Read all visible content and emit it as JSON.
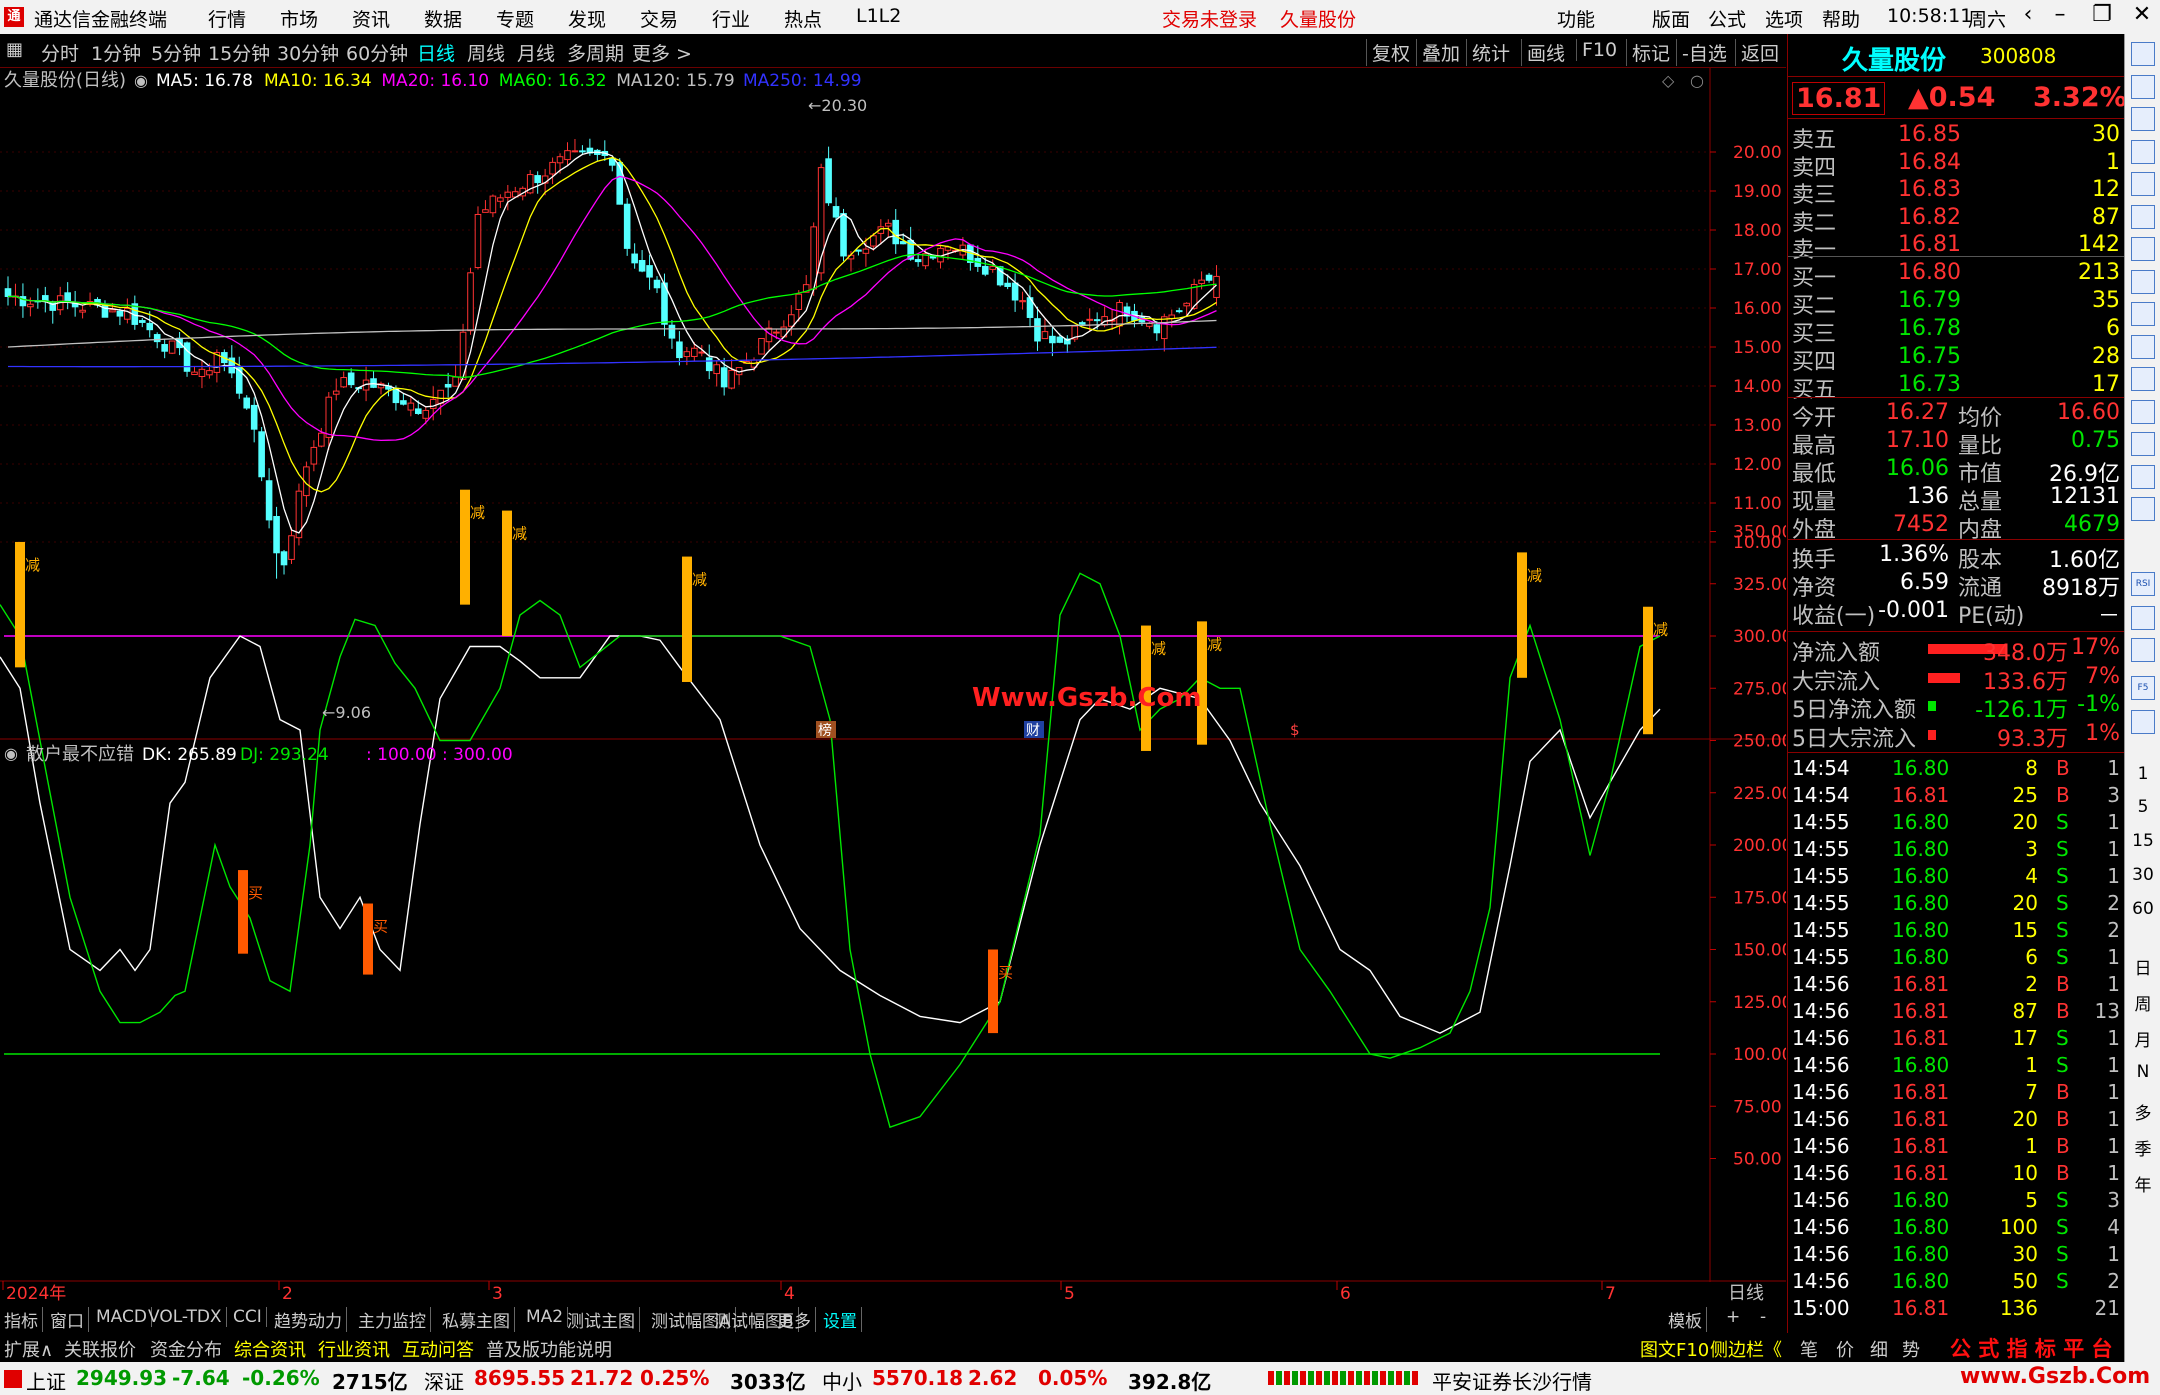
{
  "titlebar": {
    "app_title": "通达信金融终端",
    "menus": [
      "行情",
      "市场",
      "资讯",
      "数据",
      "专题",
      "发现",
      "交易",
      "行业",
      "热点",
      "L1L2"
    ],
    "trade_status": "交易未登录",
    "stock_link": "久量股份",
    "right_menus": [
      "功能",
      "版面",
      "公式",
      "选项",
      "帮助"
    ],
    "time": "10:58:11",
    "weekday": "周六"
  },
  "period_tabs": [
    "分时",
    "1分钟",
    "5分钟",
    "15分钟",
    "30分钟",
    "60分钟",
    "日线",
    "周线",
    "月线",
    "多周期",
    "更多 >"
  ],
  "selected_period": "日线",
  "tool_buttons": [
    "复权",
    "叠加",
    "统计",
    "画线",
    "F10",
    "标记",
    "-自选",
    "返回"
  ],
  "main_chart": {
    "title": "久量股份(日线)",
    "ma_labels": [
      {
        "text": "MA5: 16.78",
        "color": "#ffffff"
      },
      {
        "text": "MA10: 16.34",
        "color": "#ffff00"
      },
      {
        "text": "MA20: 16.10",
        "color": "#ff00ff"
      },
      {
        "text": "MA60: 16.32",
        "color": "#00ff00"
      },
      {
        "text": "MA120: 15.79",
        "color": "#c0c0c0"
      },
      {
        "text": "MA250: 14.99",
        "color": "#3232ff"
      }
    ],
    "y_ticks": [
      "20.00",
      "19.00",
      "18.00",
      "17.00",
      "16.00",
      "15.00",
      "14.00",
      "13.00",
      "12.00",
      "11.00",
      "10.00"
    ],
    "high_label": "20.30",
    "low_label": "9.06",
    "watermark": "Www.Gszb.Com",
    "event_marks": [
      "榜",
      "财",
      "$"
    ]
  },
  "indicator": {
    "title": "散户最不应错",
    "dk_label": "DK: 265.89",
    "dj_label": "DJ: 293.24",
    "level_label": ": 100.00 : 300.00",
    "y_ticks": [
      "350.00",
      "325.00",
      "300.00",
      "275.00",
      "250.00",
      "225.00",
      "200.00",
      "175.00",
      "150.00",
      "125.00",
      "100.00",
      "75.00",
      "50.00"
    ],
    "buy_text": "买",
    "sell_text": "减"
  },
  "x_axis": {
    "labels": [
      "2024年",
      "2",
      "3",
      "4",
      "5",
      "6",
      "7"
    ],
    "period": "日线"
  },
  "chart_data": [
    {
      "type": "candlestick",
      "ylim": [
        9,
        20.5
      ],
      "ma_series": [
        "MA5",
        "MA10",
        "MA20",
        "MA60",
        "MA120",
        "MA250"
      ],
      "ma_values": [
        16.78,
        16.34,
        16.1,
        16.32,
        15.79,
        14.99
      ],
      "high": 20.3,
      "low": 9.06,
      "last_close": 16.81
    },
    {
      "type": "line",
      "series": [
        {
          "name": "DK",
          "last": 265.89
        },
        {
          "name": "DJ",
          "last": 293.24
        }
      ],
      "levels": [
        100,
        300
      ],
      "ylim": [
        40,
        370
      ]
    }
  ],
  "quote": {
    "name": "久量股份",
    "code": "300808",
    "price": "16.81",
    "change": "▲0.54",
    "pct": "3.32%",
    "asks": [
      {
        "label": "卖五",
        "price": "16.85",
        "vol": "30"
      },
      {
        "label": "卖四",
        "price": "16.84",
        "vol": "1"
      },
      {
        "label": "卖三",
        "price": "16.83",
        "vol": "12"
      },
      {
        "label": "卖二",
        "price": "16.82",
        "vol": "87"
      },
      {
        "label": "卖一",
        "price": "16.81",
        "vol": "142"
      }
    ],
    "bids": [
      {
        "label": "买一",
        "price": "16.80",
        "vol": "213"
      },
      {
        "label": "买二",
        "price": "16.79",
        "vol": "35"
      },
      {
        "label": "买三",
        "price": "16.78",
        "vol": "6"
      },
      {
        "label": "买四",
        "price": "16.75",
        "vol": "28"
      },
      {
        "label": "买五",
        "price": "16.73",
        "vol": "17"
      }
    ],
    "stats": [
      [
        {
          "k": "今开",
          "v": "16.27",
          "c": "up"
        },
        {
          "k": "均价",
          "v": "16.60",
          "c": "up"
        }
      ],
      [
        {
          "k": "最高",
          "v": "17.10",
          "c": "up"
        },
        {
          "k": "量比",
          "v": "0.75",
          "c": "dn"
        }
      ],
      [
        {
          "k": "最低",
          "v": "16.06",
          "c": "dn"
        },
        {
          "k": "市值",
          "v": "26.9亿",
          "c": "wh"
        }
      ],
      [
        {
          "k": "现量",
          "v": "136",
          "c": "wh"
        },
        {
          "k": "总量",
          "v": "12131",
          "c": "wh"
        }
      ],
      [
        {
          "k": "外盘",
          "v": "7452",
          "c": "up"
        },
        {
          "k": "内盘",
          "v": "4679",
          "c": "dn"
        }
      ]
    ],
    "stats2": [
      [
        {
          "k": "换手",
          "v": "1.36%",
          "c": "wh"
        },
        {
          "k": "股本",
          "v": "1.60亿",
          "c": "wh"
        }
      ],
      [
        {
          "k": "净资",
          "v": "6.59",
          "c": "wh"
        },
        {
          "k": "流通",
          "v": "8918万",
          "c": "wh"
        }
      ],
      [
        {
          "k": "收益(一)",
          "v": "-0.001",
          "c": "wh"
        },
        {
          "k": "PE(动)",
          "v": "－",
          "c": "wh"
        }
      ]
    ],
    "flows": [
      {
        "k": "净流入额",
        "v": "348.0万",
        "p": "17%",
        "c": "up",
        "bar": 0.17
      },
      {
        "k": "大宗流入",
        "v": "133.6万",
        "p": "7%",
        "c": "up",
        "bar": 0.07
      },
      {
        "k": "5日净流入额",
        "v": "-126.1万",
        "p": "-1%",
        "c": "dn",
        "bar": 0.01
      },
      {
        "k": "5日大宗流入",
        "v": "93.3万",
        "p": "1%",
        "c": "up",
        "bar": 0.01
      }
    ],
    "ticks": [
      [
        "14:54",
        "16.80",
        "8",
        "B",
        "1"
      ],
      [
        "14:54",
        "16.81",
        "25",
        "B",
        "3"
      ],
      [
        "14:55",
        "16.80",
        "20",
        "S",
        "1"
      ],
      [
        "14:55",
        "16.80",
        "3",
        "S",
        "1"
      ],
      [
        "14:55",
        "16.80",
        "4",
        "S",
        "1"
      ],
      [
        "14:55",
        "16.80",
        "20",
        "S",
        "2"
      ],
      [
        "14:55",
        "16.80",
        "15",
        "S",
        "2"
      ],
      [
        "14:55",
        "16.80",
        "6",
        "S",
        "1"
      ],
      [
        "14:56",
        "16.81",
        "2",
        "B",
        "1"
      ],
      [
        "14:56",
        "16.81",
        "87",
        "B",
        "13"
      ],
      [
        "14:56",
        "16.81",
        "17",
        "S",
        "1"
      ],
      [
        "14:56",
        "16.80",
        "1",
        "S",
        "1"
      ],
      [
        "14:56",
        "16.81",
        "7",
        "B",
        "1"
      ],
      [
        "14:56",
        "16.81",
        "20",
        "B",
        "1"
      ],
      [
        "14:56",
        "16.81",
        "1",
        "B",
        "1"
      ],
      [
        "14:56",
        "16.81",
        "10",
        "B",
        "1"
      ],
      [
        "14:56",
        "16.80",
        "5",
        "S",
        "3"
      ],
      [
        "14:56",
        "16.80",
        "100",
        "S",
        "4"
      ],
      [
        "14:56",
        "16.80",
        "30",
        "S",
        "1"
      ],
      [
        "14:56",
        "16.80",
        "50",
        "S",
        "2"
      ],
      [
        "15:00",
        "16.81",
        "136",
        "",
        "21"
      ]
    ]
  },
  "bottom_tabs": [
    "指标",
    "窗口",
    "MACD",
    "VOL-TDX",
    "CCI",
    "趋势动力",
    "主力监控",
    "私募主图",
    "MA2",
    "测试主图",
    "测试幅图A",
    "测试幅图B",
    "更多",
    "设置"
  ],
  "bottom_right": [
    "模板",
    "+",
    "-"
  ],
  "info_tabs": [
    "扩展∧",
    "关联报价",
    "资金分布",
    "综合资讯",
    "行业资讯",
    "互动问答",
    "普及版功能说明"
  ],
  "info_right": [
    "图文F10",
    "侧边栏《",
    "笔",
    "价",
    "细",
    "势"
  ],
  "brand_text": "公 式 指 标 平 台",
  "brand_url": "www.Gszb.Com",
  "statusbar": {
    "indices": [
      {
        "name": "上证",
        "value": "2949.93",
        "chg": "-7.64",
        "pct": "-0.26%",
        "amt": "2715亿",
        "c": "dn"
      },
      {
        "name": "深证",
        "value": "8695.55",
        "chg": "21.72",
        "pct": "0.25%",
        "amt": "3033亿",
        "c": "up"
      },
      {
        "name": "中小",
        "value": "5570.18",
        "chg": "2.62",
        "pct": "0.05%",
        "amt": "392.8亿",
        "c": "up"
      }
    ],
    "broker": "平安证券长沙行情"
  },
  "sidebar_labels": [
    "1",
    "5",
    "15",
    "30",
    "60",
    "日",
    "周",
    "月",
    "N",
    "多",
    "季",
    "年"
  ],
  "sidebar_icons": [
    "RSI",
    "F10"
  ]
}
